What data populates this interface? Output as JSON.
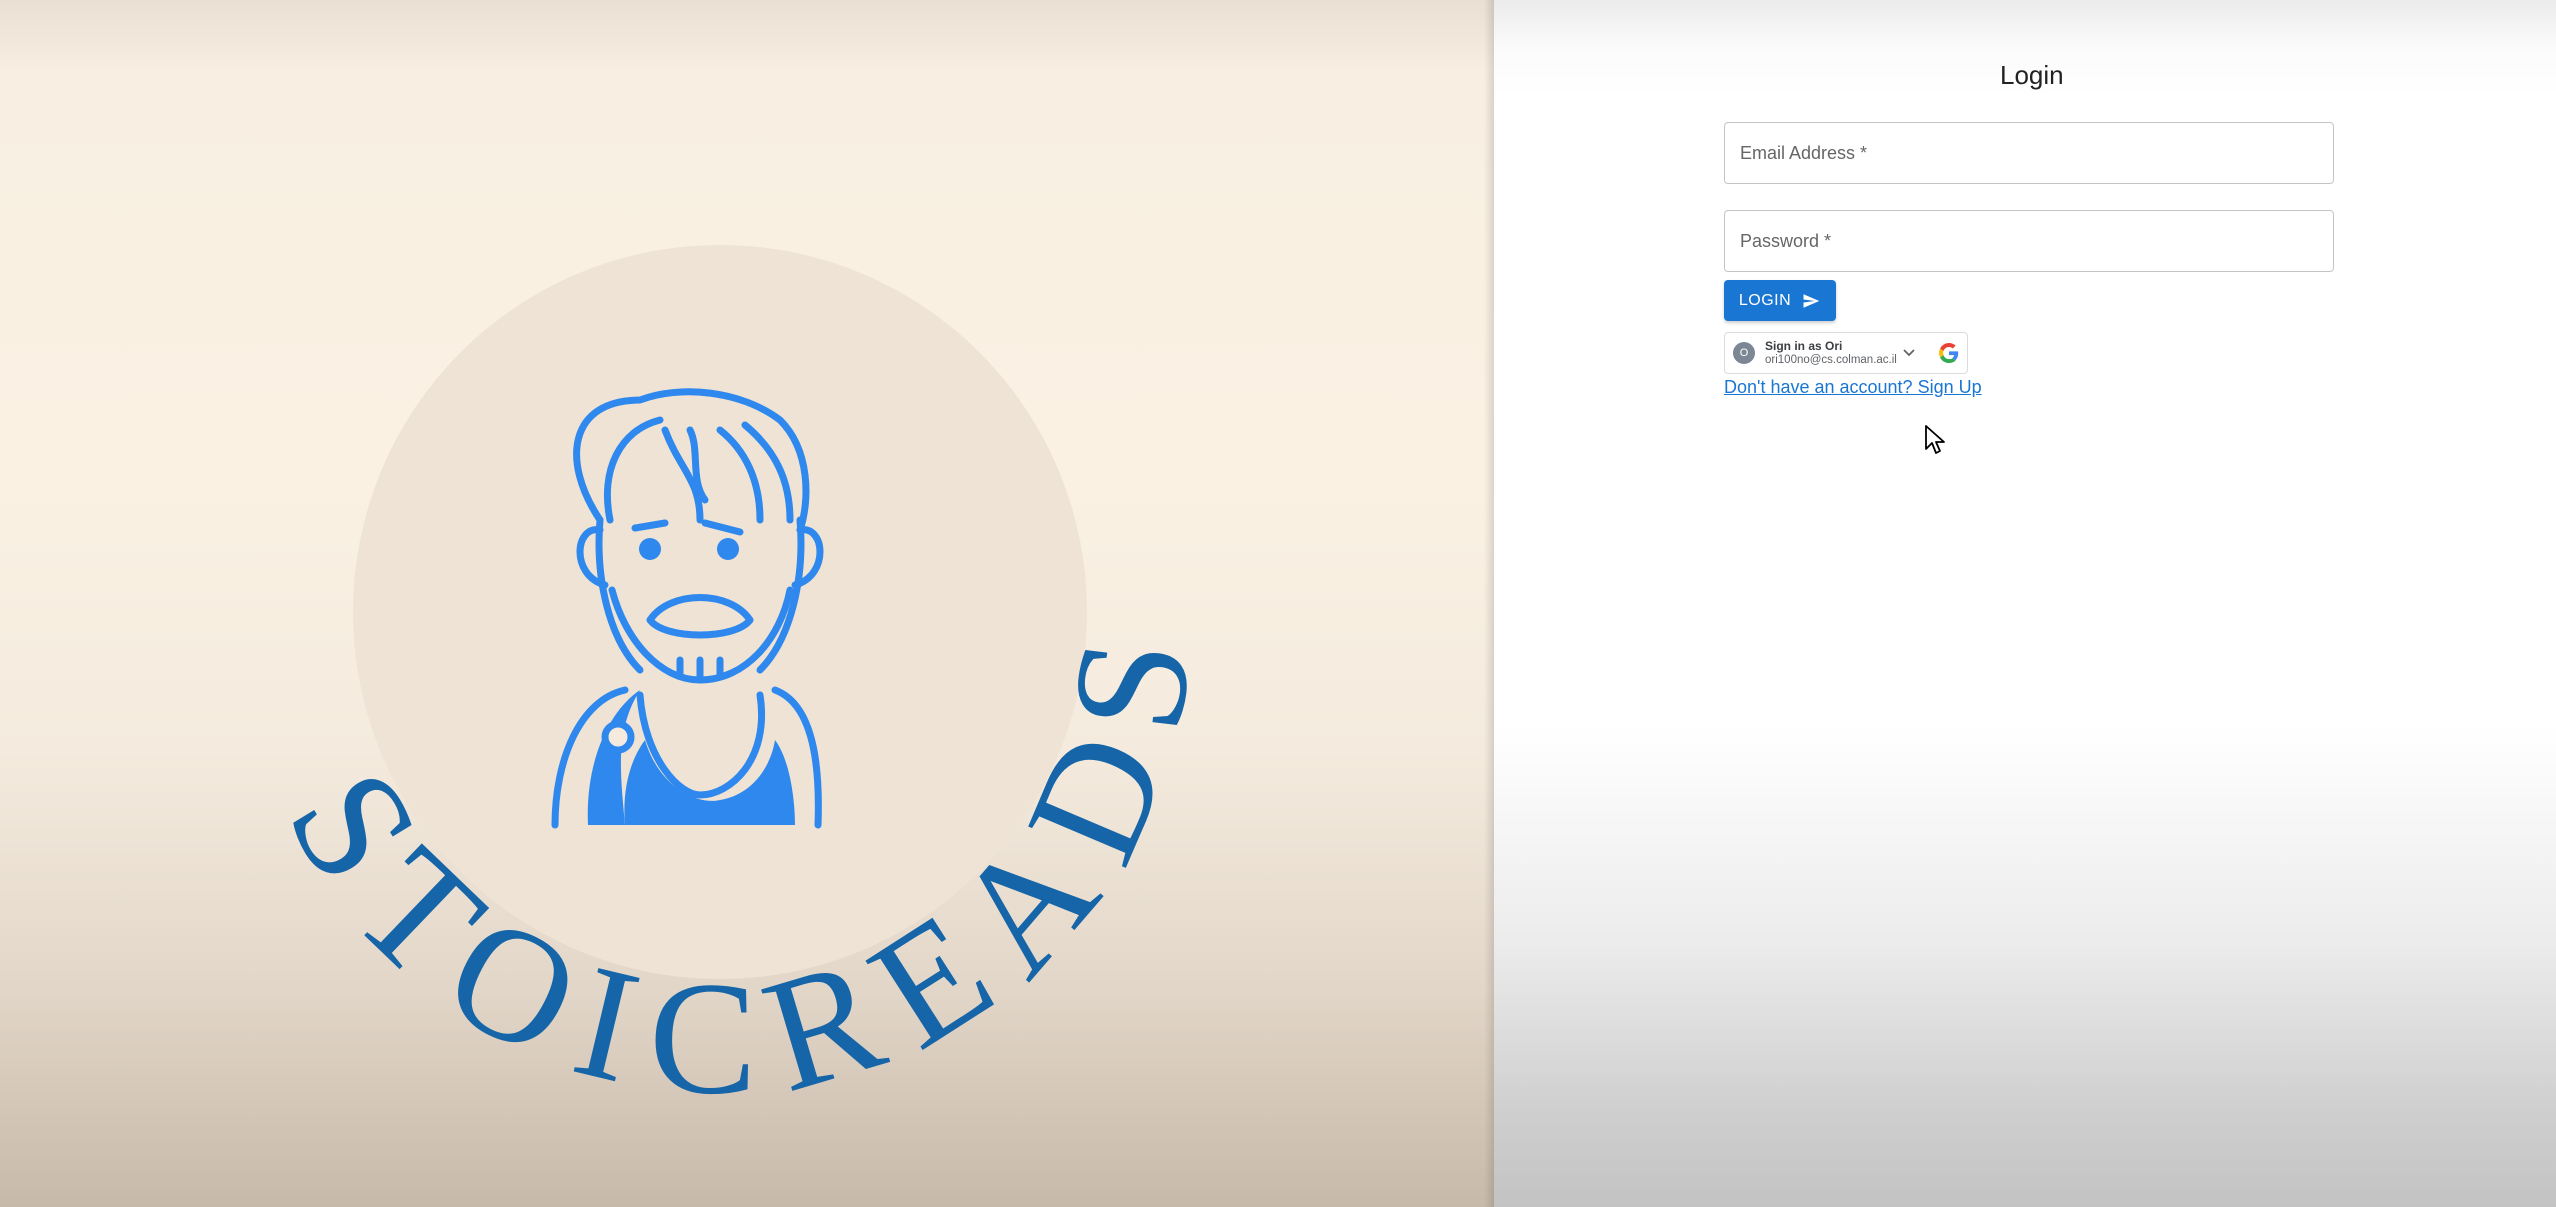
{
  "brand": {
    "name": "STOICREADS",
    "letters": [
      "S",
      "T",
      "O",
      "I",
      "C",
      "R",
      "E",
      "A",
      "D",
      "S"
    ],
    "primary_color": "#1565a8",
    "icon_color": "#2e88ee"
  },
  "login": {
    "title": "Login",
    "email_placeholder": "Email Address *",
    "password_placeholder": "Password *",
    "login_button": "LOGIN",
    "signup_link": "Don't have an account? Sign Up"
  },
  "google": {
    "avatar_initial": "O",
    "sign_in_as": "Sign in as Ori",
    "email": "ori100no@cs.colman.ac.il"
  }
}
